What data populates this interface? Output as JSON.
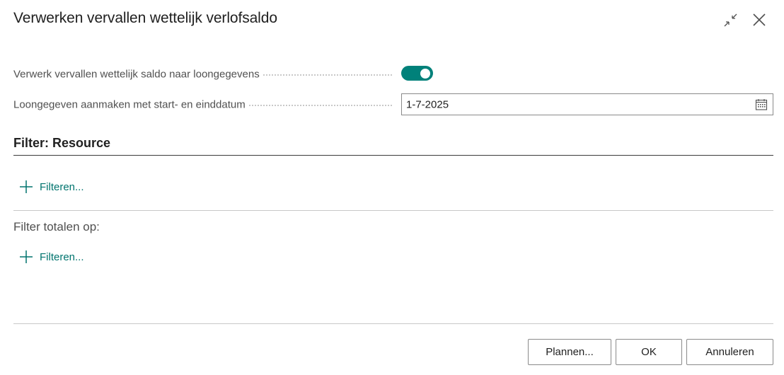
{
  "dialog": {
    "title": "Verwerken vervallen wettelijk verlofsaldo"
  },
  "header_icons": {
    "collapse": "collapse-icon",
    "close": "close-icon"
  },
  "fields": {
    "process_expired": {
      "label": "Verwerk vervallen wettelijk saldo naar loongegevens",
      "value": true
    },
    "payroll_date": {
      "label": "Loongegeven aanmaken met start- en einddatum",
      "value": "1-7-2025"
    }
  },
  "filter_resource": {
    "title": "Filter: Resource",
    "add_label": "Filteren..."
  },
  "filter_totals": {
    "title": "Filter totalen op:",
    "add_label": "Filteren..."
  },
  "buttons": {
    "plan": "Plannen...",
    "ok": "OK",
    "cancel": "Annuleren"
  },
  "colors": {
    "accent": "#00817a",
    "link": "#00746e"
  }
}
